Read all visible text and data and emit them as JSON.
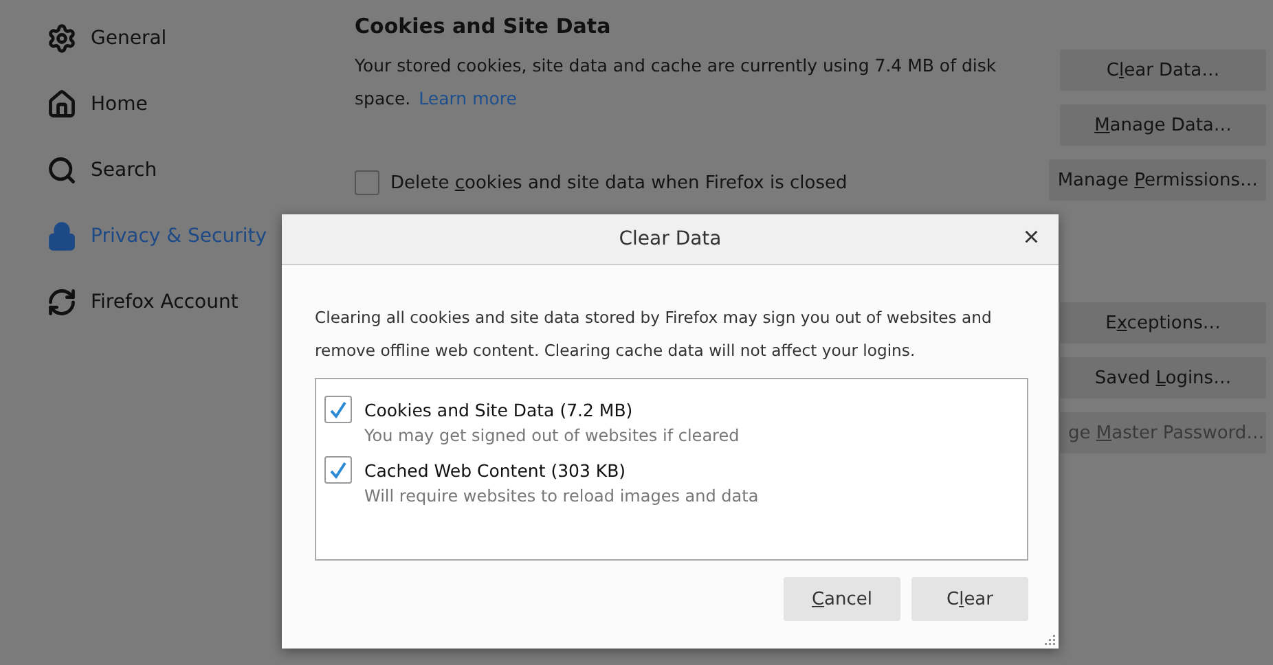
{
  "sidebar": {
    "items": [
      {
        "label": "General",
        "selected": false
      },
      {
        "label": "Home",
        "selected": false
      },
      {
        "label": "Search",
        "selected": false
      },
      {
        "label": "Privacy & Security",
        "selected": true
      },
      {
        "label": "Firefox Account",
        "selected": false
      }
    ]
  },
  "section": {
    "title": "Cookies and Site Data",
    "description": "Your stored cookies, site data and cache are currently using 7.4 MB of disk space.",
    "link": "Learn more",
    "checkbox": {
      "label": [
        {
          "text": "Delete ",
          "underlined": false
        },
        {
          "text": "c",
          "underlined": true
        },
        {
          "text": "ookies and site data when Firefox is closed",
          "underlined": false
        }
      ],
      "checked": false
    },
    "buttons": [
      {
        "label": [
          {
            "text": "C",
            "underlined": false
          },
          {
            "text": "l",
            "underlined": true
          },
          {
            "text": "ear Data…",
            "underlined": false
          }
        ],
        "disabled": false
      },
      {
        "label": [
          {
            "text": "M",
            "underlined": true
          },
          {
            "text": "anage Data…",
            "underlined": false
          }
        ],
        "disabled": false
      },
      {
        "label": [
          {
            "text": "Manage ",
            "underlined": false
          },
          {
            "text": "P",
            "underlined": true
          },
          {
            "text": "ermissions…",
            "underlined": false
          }
        ],
        "disabled": false
      }
    ]
  },
  "more_buttons": [
    {
      "label": [
        {
          "text": "E",
          "underlined": false
        },
        {
          "text": "x",
          "underlined": true
        },
        {
          "text": "ceptions…",
          "underlined": false
        }
      ],
      "disabled": false
    },
    {
      "label": [
        {
          "text": "Saved ",
          "underlined": false
        },
        {
          "text": "L",
          "underlined": true
        },
        {
          "text": "ogins…",
          "underlined": false
        }
      ],
      "disabled": false
    },
    {
      "label": [
        {
          "text": "ge ",
          "underlined": false
        },
        {
          "text": "M",
          "underlined": true
        },
        {
          "text": "aster Password…",
          "underlined": false
        }
      ],
      "disabled": true
    }
  ],
  "dialog": {
    "title": "Clear Data",
    "close": "×",
    "message": "Clearing all cookies and site data stored by Firefox may sign you out of websites and remove offline web content. Clearing cache data will not affect your logins.",
    "options": [
      {
        "label": "Cookies and Site Data (7.2 MB)",
        "hint": "You may get signed out of websites if cleared",
        "checked": true
      },
      {
        "label": "Cached Web Content (303 KB)",
        "hint": "Will require websites to reload images and data",
        "checked": true
      }
    ],
    "buttons": [
      {
        "label": [
          {
            "text": "C",
            "underlined": true
          },
          {
            "text": "ancel",
            "underlined": false
          }
        ]
      },
      {
        "label": [
          {
            "text": "C",
            "underlined": false
          },
          {
            "text": "l",
            "underlined": true
          },
          {
            "text": "ear",
            "underlined": false
          }
        ]
      }
    ]
  }
}
